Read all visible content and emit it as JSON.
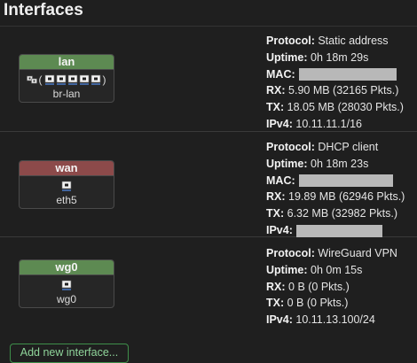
{
  "page": {
    "title": "Interfaces"
  },
  "interfaces": [
    {
      "name": "lan",
      "device": "br-lan",
      "status_color": "#5d8a52",
      "bridge_ports": 5,
      "icon": "ethernet-port-icon",
      "details": {
        "protocol_label": "Protocol:",
        "protocol": "Static address",
        "uptime_label": "Uptime:",
        "uptime": "0h 18m 29s",
        "mac_label": "MAC:",
        "rx_label": "RX:",
        "rx": "5.90 MB (32165 Pkts.)",
        "tx_label": "TX:",
        "tx": "18.05 MB (28030 Pkts.)",
        "ipv4_label": "IPv4:",
        "ipv4": "10.11.11.1/16"
      }
    },
    {
      "name": "wan",
      "device": "eth5",
      "status_color": "#8c4a4a",
      "icon": "ethernet-port-icon",
      "details": {
        "protocol_label": "Protocol:",
        "protocol": "DHCP client",
        "uptime_label": "Uptime:",
        "uptime": "0h 18m 23s",
        "mac_label": "MAC:",
        "rx_label": "RX:",
        "rx": "19.89 MB (62946 Pkts.)",
        "tx_label": "TX:",
        "tx": "6.32 MB (32982 Pkts.)",
        "ipv4_label": "IPv4:"
      }
    },
    {
      "name": "wg0",
      "device": "wg0",
      "status_color": "#5d8a52",
      "icon": "tunnel-icon",
      "details": {
        "protocol_label": "Protocol:",
        "protocol": "WireGuard VPN",
        "uptime_label": "Uptime:",
        "uptime": "0h 0m 15s",
        "rx_label": "RX:",
        "rx": "0 B (0 Pkts.)",
        "tx_label": "TX:",
        "tx": "0 B (0 Pkts.)",
        "ipv4_label": "IPv4:",
        "ipv4": "10.11.13.100/24"
      }
    }
  ],
  "actions": {
    "add_label": "Add new interface..."
  }
}
